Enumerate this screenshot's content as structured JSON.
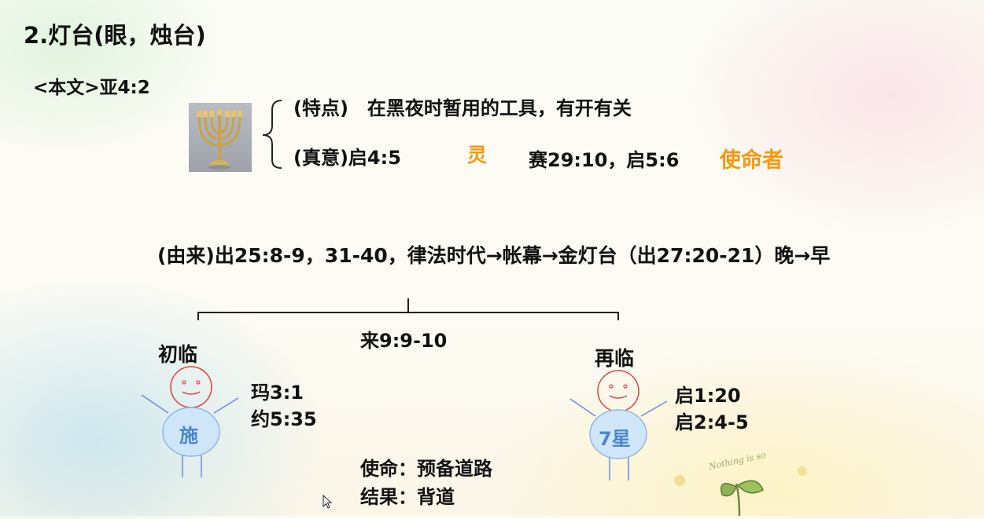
{
  "slide": {
    "title": "2.灯台(眼，烛台)",
    "reference": "<本文>亚4:2",
    "features": "(特点)　在黑夜时暂用的工具，有开有关",
    "true_meaning": "(真意)启4:5",
    "spirit": "灵",
    "verses": "赛29:10，启5:6",
    "messenger": "使命者",
    "origin": "(由来)出25:8-9，31-40，律法时代→帐幕→金灯台（出27:20-21）晚→早",
    "hebrews_ref": "来9:9-10",
    "first_coming": {
      "label": "初临",
      "body_text": "施",
      "refs": [
        "玛3:1",
        "约5:35"
      ]
    },
    "second_coming": {
      "label": "再临",
      "body_text": "7星",
      "refs": [
        "启1:20",
        "启2:4-5"
      ]
    },
    "mission": "使命：预备道路",
    "result": "结果：背道",
    "decor_text": "Nothing is so"
  },
  "colors": {
    "highlight": "#f29a12",
    "figure_head_stroke": "#e0403c",
    "figure_body_fill": "#cfe6f8",
    "figure_body_text": "#4a86c8",
    "figure_limbs": "#6a8fd6"
  },
  "icons": [
    "menorah-image",
    "curly-bracket-icon",
    "mouse-pointer-icon",
    "sprout-decoration"
  ]
}
